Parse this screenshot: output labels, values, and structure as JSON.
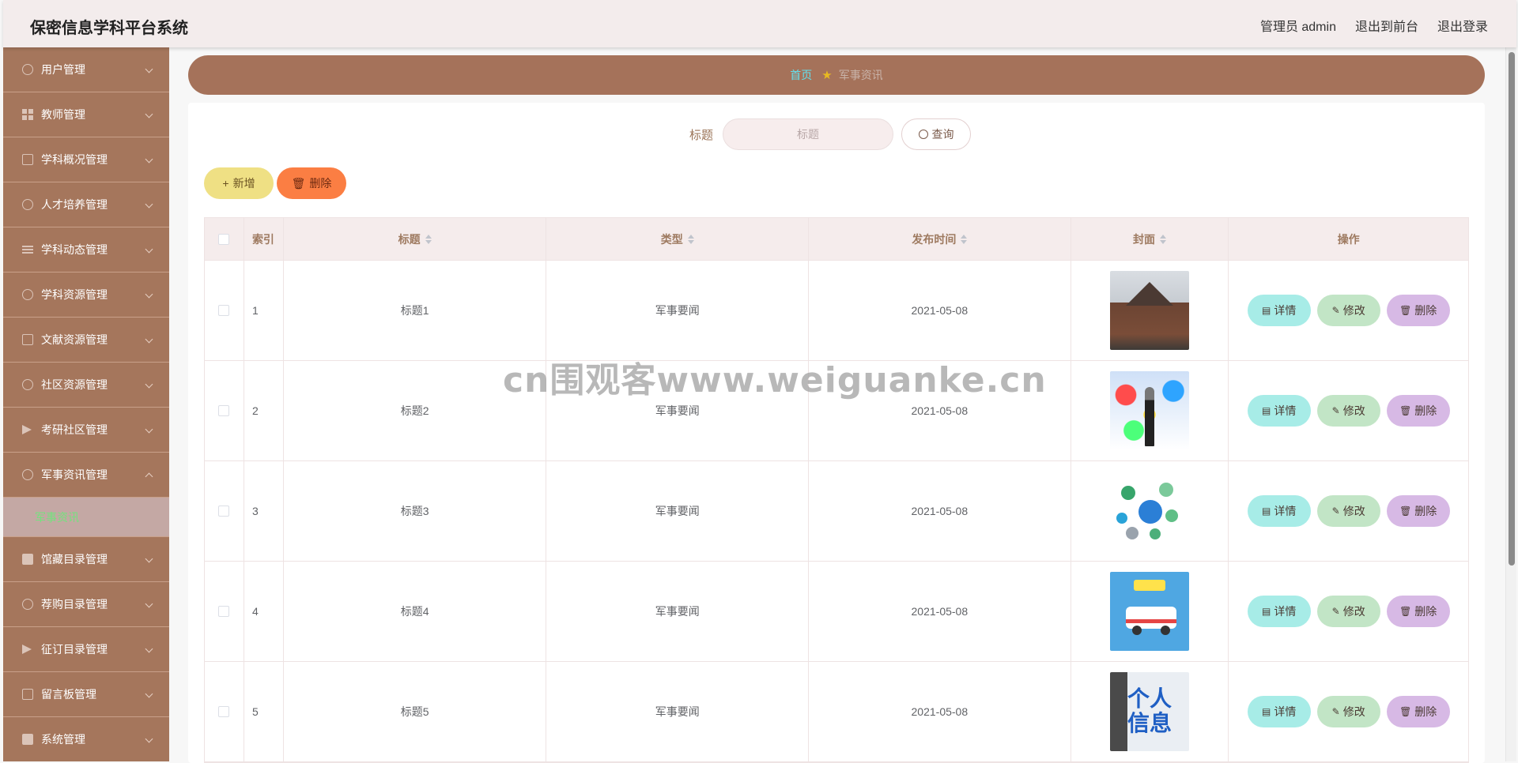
{
  "header": {
    "title": "保密信息学科平台系统",
    "user": "管理员 admin",
    "to_front": "退出到前台",
    "logout": "退出登录"
  },
  "sidebar": {
    "items": [
      {
        "label": "用户管理",
        "icon": "user-icon"
      },
      {
        "label": "教师管理",
        "icon": "grid-icon"
      },
      {
        "label": "学科概况管理",
        "icon": "documents-icon"
      },
      {
        "label": "人才培养管理",
        "icon": "globe-icon"
      },
      {
        "label": "学科动态管理",
        "icon": "list-icon"
      },
      {
        "label": "学科资源管理",
        "icon": "clock-icon"
      },
      {
        "label": "文献资源管理",
        "icon": "mail-icon"
      },
      {
        "label": "社区资源管理",
        "icon": "compass-icon"
      },
      {
        "label": "考研社区管理",
        "icon": "send-icon"
      },
      {
        "label": "军事资讯管理",
        "icon": "microphone-icon"
      },
      {
        "label": "馆藏目录管理",
        "icon": "picture-icon"
      },
      {
        "label": "荐购目录管理",
        "icon": "dashboard-icon"
      },
      {
        "label": "征订目录管理",
        "icon": "location-icon"
      },
      {
        "label": "留言板管理",
        "icon": "phone-icon"
      },
      {
        "label": "系统管理",
        "icon": "monitor-icon"
      }
    ],
    "active_submenu": "军事资讯"
  },
  "breadcrumb": {
    "home": "首页",
    "current": "军事资讯"
  },
  "search": {
    "label": "标题",
    "placeholder": "标题",
    "button": "查询"
  },
  "actions": {
    "add": "新增",
    "delete": "删除"
  },
  "table": {
    "columns": [
      "索引",
      "标题",
      "类型",
      "发布时间",
      "封面",
      "操作"
    ],
    "rows": [
      {
        "index": "1",
        "title": "标题1",
        "type": "军事要闻",
        "time": "2021-05-08"
      },
      {
        "index": "2",
        "title": "标题2",
        "type": "军事要闻",
        "time": "2021-05-08"
      },
      {
        "index": "3",
        "title": "标题3",
        "type": "军事要闻",
        "time": "2021-05-08"
      },
      {
        "index": "4",
        "title": "标题4",
        "type": "军事要闻",
        "time": "2021-05-08"
      },
      {
        "index": "5",
        "title": "标题5",
        "type": "军事要闻",
        "time": "2021-05-08"
      }
    ],
    "ops": {
      "detail": "详情",
      "edit": "修改",
      "delete": "删除"
    }
  },
  "cover_art": {
    "row_5": [
      "个人",
      "信息"
    ]
  },
  "watermark": "cn围观客www.weiguanke.cn",
  "colors": {
    "sidebar": "#a5765c",
    "breadcrumb": "#a5725a",
    "header": "#f3ecec",
    "add_button": "#efe084",
    "delete_button": "#fb7e43",
    "detail_button": "#a7ece7",
    "edit_button": "#c2e5c6",
    "row_delete_button": "#d7b9e5"
  }
}
